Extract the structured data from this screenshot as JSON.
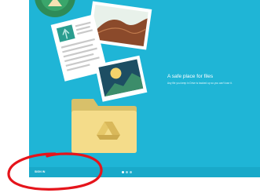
{
  "welcome": {
    "headline": "A safe place for files",
    "subline": "Any file you keep in Drive is backed up so you can't lose it."
  },
  "footer": {
    "sign_in_label": "SIGN IN",
    "page_count": 3,
    "active_page": 1
  },
  "colors": {
    "background": "#1fb5d6",
    "annotation": "#e5141b"
  }
}
